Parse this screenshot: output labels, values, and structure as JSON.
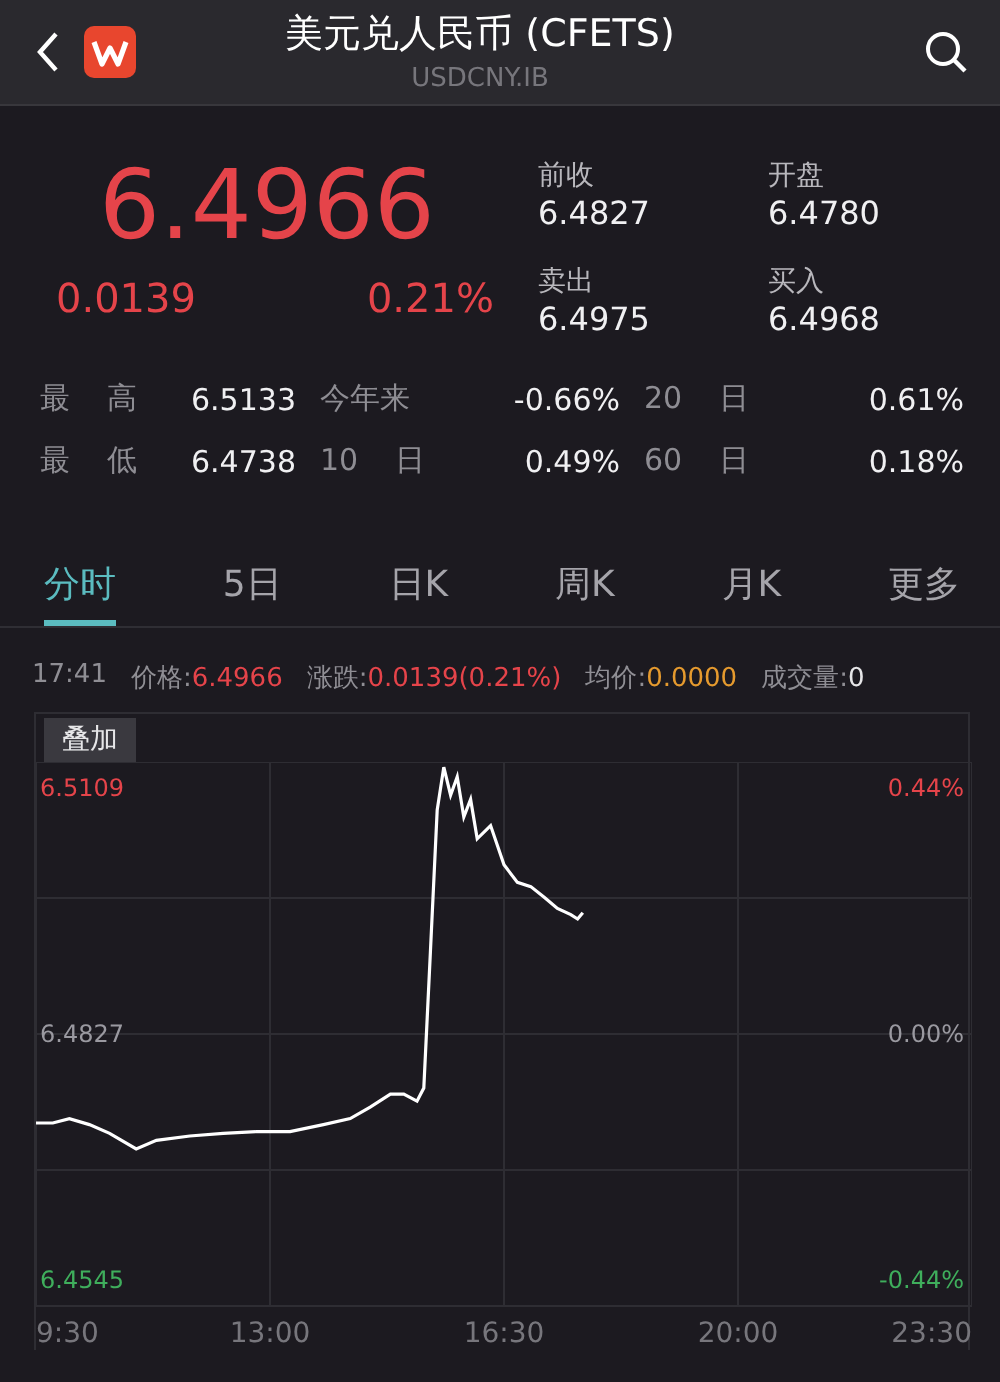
{
  "header": {
    "title": "美元兑人民币 (CFETS)",
    "subtitle": "USDCNY.IB"
  },
  "quote": {
    "price": "6.4966",
    "change": "0.0139",
    "change_pct": "0.21%",
    "fields": [
      {
        "label": "前收",
        "value": "6.4827"
      },
      {
        "label": "开盘",
        "value": "6.4780"
      },
      {
        "label": "卖出",
        "value": "6.4975"
      },
      {
        "label": "买入",
        "value": "6.4968"
      }
    ]
  },
  "stats": [
    [
      {
        "label": "最 高",
        "value": "6.5133"
      },
      {
        "label": "今年来",
        "value": "-0.66%"
      },
      {
        "label": "20 日",
        "value": "0.61%"
      }
    ],
    [
      {
        "label": "最 低",
        "value": "6.4738"
      },
      {
        "label": "10 日",
        "value": "0.49%"
      },
      {
        "label": "60 日",
        "value": "0.18%"
      }
    ]
  ],
  "tabs": [
    {
      "label": "分时",
      "selected": true
    },
    {
      "label": "5日",
      "selected": false
    },
    {
      "label": "日K",
      "selected": false
    },
    {
      "label": "周K",
      "selected": false
    },
    {
      "label": "月K",
      "selected": false
    },
    {
      "label": "更多",
      "selected": false
    }
  ],
  "info": {
    "time": "17:41",
    "items": [
      {
        "label": "价格:",
        "value": "6.4966",
        "kind": "up"
      },
      {
        "label": "涨跌:",
        "value": "0.0139(0.21%)",
        "kind": "up"
      },
      {
        "label": "均价:",
        "value": "0.0000",
        "kind": "avg"
      },
      {
        "label": "成交量:",
        "value": "0",
        "kind": "plain"
      }
    ]
  },
  "chart": {
    "overlay_button": "叠加",
    "pct_labels": [
      {
        "text": "0.44%",
        "kind": "up"
      },
      {
        "text": "0.00%",
        "kind": "flat"
      },
      {
        "text": "-0.44%",
        "kind": "down"
      }
    ],
    "chart_data": {
      "type": "line",
      "x": [
        9.5,
        9.75,
        10.0,
        10.3,
        10.6,
        11.0,
        11.3,
        11.8,
        12.3,
        12.8,
        13.3,
        13.8,
        14.2,
        14.5,
        14.8,
        15.0,
        15.2,
        15.3,
        15.4,
        15.5,
        15.6,
        15.7,
        15.8,
        15.9,
        16.0,
        16.1,
        16.3,
        16.5,
        16.7,
        16.9,
        17.1,
        17.3,
        17.5,
        17.6,
        17.68
      ],
      "series": [
        {
          "color": "#ffffff",
          "values": [
            6.4725,
            6.4725,
            6.473,
            6.4723,
            6.4713,
            6.4695,
            6.4705,
            6.471,
            6.4713,
            6.4715,
            6.4715,
            6.4723,
            6.473,
            6.4743,
            6.4758,
            6.4758,
            6.475,
            6.4765,
            6.4921,
            6.5084,
            6.5133,
            6.5101,
            6.5122,
            6.5076,
            6.5096,
            6.5051,
            6.5066,
            6.5021,
            6.5001,
            6.4996,
            6.4984,
            6.4971,
            6.4964,
            6.4959,
            6.4966
          ]
        }
      ],
      "xlim": [
        9.5,
        23.5
      ],
      "ylim": [
        6.4515,
        6.5139
      ],
      "grid": true,
      "xticks": [
        {
          "value": 9.5,
          "label": "9:30"
        },
        {
          "value": 13,
          "label": "13:00"
        },
        {
          "value": 16.5,
          "label": "16:30"
        },
        {
          "value": 20,
          "label": "20:00"
        },
        {
          "value": 23.5,
          "label": "23:30"
        }
      ],
      "yticks": [
        {
          "value": 6.5109,
          "label": "6.5109"
        },
        {
          "value": 6.4827,
          "label": "6.4827"
        },
        {
          "value": 6.4545,
          "label": "6.4545"
        }
      ]
    }
  }
}
